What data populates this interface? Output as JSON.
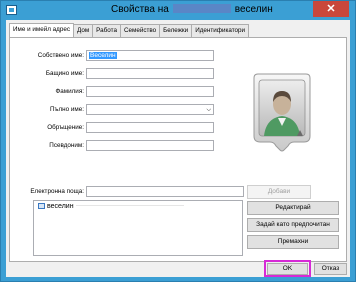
{
  "window": {
    "title_prefix": "Свойства на",
    "title_suffix": "веселин",
    "close_glyph": "✕"
  },
  "tabs": [
    {
      "label": "Име и имейл адрес",
      "active": true
    },
    {
      "label": "Дом",
      "active": false
    },
    {
      "label": "Работа",
      "active": false
    },
    {
      "label": "Семейство",
      "active": false
    },
    {
      "label": "Бележки",
      "active": false
    },
    {
      "label": "Идентификатори",
      "active": false
    }
  ],
  "form": {
    "first_name_label": "Собствено име:",
    "first_name_value": "Веселин",
    "middle_name_label": "Бащино име:",
    "middle_name_value": "",
    "last_name_label": "Фамилия:",
    "last_name_value": "",
    "full_name_label": "Пълно име:",
    "full_name_value": "",
    "title_label": "Обръщение:",
    "title_value": "",
    "nickname_label": "Псевдоним:",
    "nickname_value": "",
    "email_label": "Електронна поща:",
    "email_value": ""
  },
  "email_list": {
    "items": [
      "веселин"
    ]
  },
  "buttons": {
    "add": "Добави",
    "edit": "Редактирай",
    "set_preferred": "Задай като предпочитан",
    "remove": "Премахни",
    "ok": "OK",
    "cancel": "Отказ"
  },
  "icons": {
    "avatar": "contact-avatar-icon",
    "dropdown": "chevron-down-icon"
  },
  "colors": {
    "titlebar": "#3b9fd4",
    "close_button": "#c9473b",
    "ok_highlight": "#d62ad6",
    "selection": "#3399ff"
  }
}
